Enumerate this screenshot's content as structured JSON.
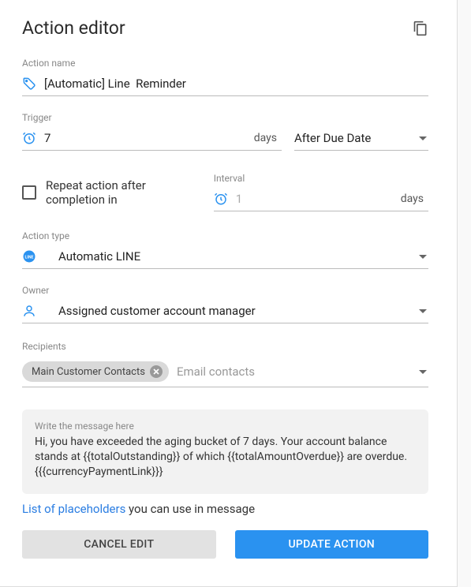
{
  "header": {
    "title": "Action editor"
  },
  "actionName": {
    "label": "Action name",
    "value": "[Automatic] Line  Reminder"
  },
  "trigger": {
    "label": "Trigger",
    "value": "7",
    "unit": "days",
    "when": "After Due Date"
  },
  "repeat": {
    "label": "Repeat action after completion in",
    "intervalLabel": "Interval",
    "intervalValue": "1",
    "intervalUnit": "days"
  },
  "actionType": {
    "label": "Action type",
    "value": "Automatic LINE"
  },
  "owner": {
    "label": "Owner",
    "value": "Assigned customer account manager"
  },
  "recipients": {
    "label": "Recipients",
    "chip": "Main Customer Contacts",
    "placeholder": "Email contacts"
  },
  "message": {
    "placeholder": "Write the message here",
    "body": "Hi, you have exceeded the aging bucket of 7 days. Your account balance stands at {{totalOutstanding}} of which {{totalAmountOverdue}} are overdue. {{{currencyPaymentLink}}}"
  },
  "placeholders": {
    "link": "List of placeholders",
    "rest": " you can use in message"
  },
  "buttons": {
    "cancel": "CANCEL EDIT",
    "update": "UPDATE ACTION"
  }
}
